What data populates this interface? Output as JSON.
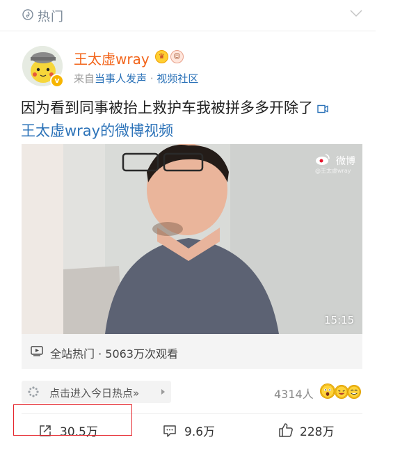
{
  "header": {
    "title": "热门"
  },
  "post": {
    "author": {
      "name": "王太虚wray"
    },
    "source": {
      "prefix": "来自",
      "origin": "当事人发声",
      "separator": "·",
      "channel": "视频社区"
    },
    "text": "因为看到同事被抬上救护车我被拼多多开除了",
    "video_link": "王太虚wray的微博视频",
    "video": {
      "watermark": "微博",
      "watermark_sub": "@王太虚wray",
      "duration": "15:15",
      "views": "全站热门 · 5063万次观看"
    },
    "hot_topic": {
      "label": "点击进入今日热点»"
    },
    "reactions_count": "4314人",
    "actions": {
      "reposts": "30.5万",
      "comments": "9.6万",
      "likes": "228万"
    }
  },
  "colors": {
    "username": "#f2641a",
    "link": "#2b72b8",
    "highlight": "#e5262d"
  }
}
